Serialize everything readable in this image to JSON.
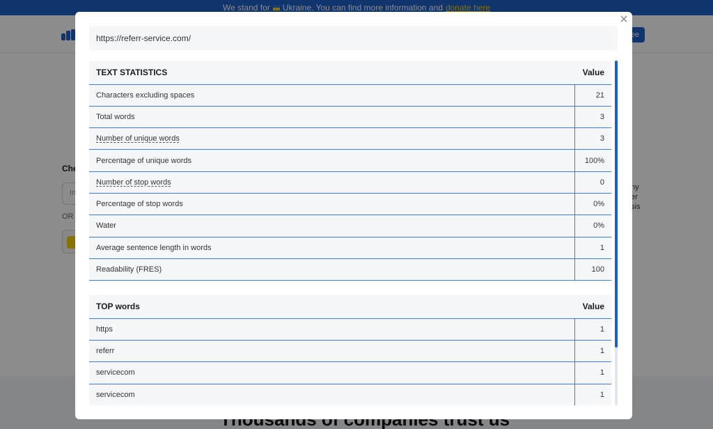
{
  "banner": {
    "text": "We stand for",
    "country": "Ukraine. You can find more information and",
    "link": "donate here"
  },
  "background": {
    "header_button": "ee",
    "check_label": "Che",
    "input_stub": "In",
    "or_label": "OR",
    "right_text": "ny\ner\nsis",
    "bottom_heading": "Thousands of companies trust us"
  },
  "modal": {
    "url": "https://referr-service.com/",
    "close_glyph": "×",
    "text_statistics": {
      "header_label": "TEXT STATISTICS",
      "header_value": "Value",
      "rows": [
        {
          "label": "Characters excluding spaces",
          "value": "21",
          "dotted": false
        },
        {
          "label": "Total words",
          "value": "3",
          "dotted": false
        },
        {
          "label": "Number of unique words",
          "value": "3",
          "dotted": true
        },
        {
          "label": "Percentage of unique words",
          "value": "100%",
          "dotted": false
        },
        {
          "label": "Number of stop words",
          "value": "0",
          "dotted": true
        },
        {
          "label": "Percentage of stop words",
          "value": "0%",
          "dotted": false
        },
        {
          "label": "Water",
          "value": "0%",
          "dotted": false
        },
        {
          "label": "Average sentence length in words",
          "value": "1",
          "dotted": false
        },
        {
          "label": "Readability (FRES)",
          "value": "100",
          "dotted": false
        }
      ]
    },
    "top_words": {
      "header_label": "TOP words",
      "header_value": "Value",
      "rows": [
        {
          "label": "https",
          "value": "1"
        },
        {
          "label": "referr",
          "value": "1"
        },
        {
          "label": "servicecom",
          "value": "1"
        },
        {
          "label": "servicecom",
          "value": "1"
        }
      ]
    }
  }
}
